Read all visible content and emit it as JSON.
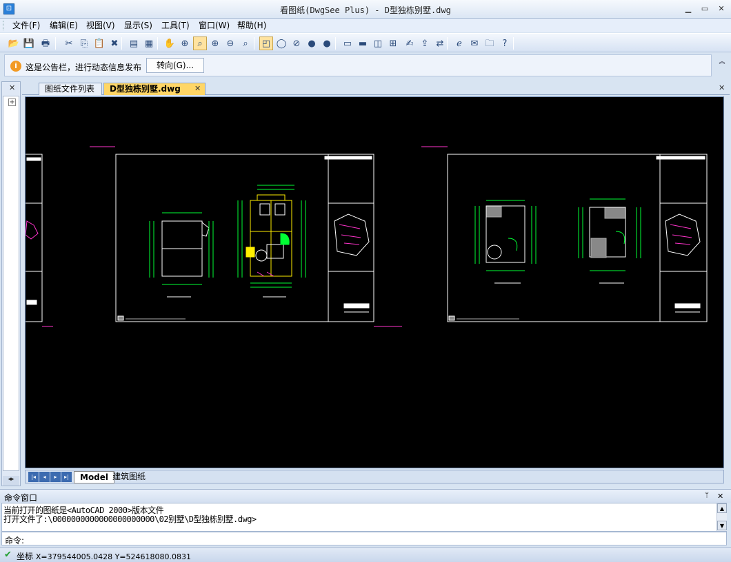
{
  "window": {
    "title": "看图纸(DwgSee Plus) - D型独栋别墅.dwg",
    "minimize": "▁",
    "maximize": "▭",
    "close": "✕"
  },
  "menu": [
    {
      "label": "文件(F)"
    },
    {
      "label": "编辑(E)"
    },
    {
      "label": "视图(V)"
    },
    {
      "label": "显示(S)"
    },
    {
      "label": "工具(T)"
    },
    {
      "label": "窗口(W)"
    },
    {
      "label": "帮助(H)"
    }
  ],
  "toolbar": {
    "icons": [
      {
        "name": "open-icon",
        "glyph": "📂"
      },
      {
        "name": "save-icon",
        "glyph": "💾"
      },
      {
        "name": "print-icon",
        "glyph": "🖶"
      },
      {
        "name": "cut-icon",
        "glyph": "✂"
      },
      {
        "name": "copy-icon",
        "glyph": "⎘"
      },
      {
        "name": "paste-icon",
        "glyph": "📋"
      },
      {
        "name": "delete-icon",
        "glyph": "✖"
      },
      {
        "name": "list-icon",
        "glyph": "▤"
      },
      {
        "name": "select-icon",
        "glyph": "▦"
      },
      {
        "name": "pan-icon",
        "glyph": "✋"
      },
      {
        "name": "zoom-window-icon",
        "glyph": "⊕"
      },
      {
        "name": "zoom-extents-icon",
        "glyph": "⌕"
      },
      {
        "name": "zoom-in-icon",
        "glyph": "⊕"
      },
      {
        "name": "zoom-out-icon",
        "glyph": "⊖"
      },
      {
        "name": "zoom-previous-icon",
        "glyph": "⌕"
      },
      {
        "name": "layer-icon",
        "glyph": "◰"
      },
      {
        "name": "circle-outline-icon",
        "glyph": "◯"
      },
      {
        "name": "circle-slash-icon",
        "glyph": "⊘"
      },
      {
        "name": "circle-fill-icon",
        "glyph": "●"
      },
      {
        "name": "circle-fill-2-icon",
        "glyph": "●"
      },
      {
        "name": "window-icon",
        "glyph": "▭"
      },
      {
        "name": "layout-icon",
        "glyph": "▬"
      },
      {
        "name": "split-icon",
        "glyph": "◫"
      },
      {
        "name": "measure-icon",
        "glyph": "⊞"
      },
      {
        "name": "text-icon",
        "glyph": "✍"
      },
      {
        "name": "export-icon",
        "glyph": "⇪"
      },
      {
        "name": "convert-icon",
        "glyph": "⇄"
      },
      {
        "name": "browser-icon",
        "glyph": "ℯ"
      },
      {
        "name": "send-icon",
        "glyph": "✉"
      },
      {
        "name": "folder-icon",
        "glyph": "🗀"
      },
      {
        "name": "help-icon",
        "glyph": "?"
      }
    ]
  },
  "notice": {
    "icon": "i",
    "text": "这是公告栏，进行动态信息发布",
    "button": "转向(G)...",
    "chevron": "︽"
  },
  "left_panel": {
    "close": "✕",
    "tree_toggle": "+",
    "arrows": "◂▸"
  },
  "tabs": [
    {
      "label": "图纸文件列表",
      "active": false
    },
    {
      "label": "D型独栋别墅.dwg",
      "active": true
    }
  ],
  "tab_close": "✕",
  "tabrow_close": "✕",
  "sheets": {
    "nav": [
      "|◂",
      "◂",
      "▸",
      "▸|"
    ],
    "tabs": [
      {
        "label": "Model",
        "active": true
      },
      {
        "label": "建筑图纸",
        "active": false
      }
    ]
  },
  "command": {
    "header": "命令窗口",
    "pin": "ᛘ",
    "close": "✕",
    "log": [
      "当前打开的图纸是<AutoCAD 2000>版本文件",
      "打开文件了:\\0000000000000000000000\\02别墅\\D型独栋别墅.dwg>"
    ],
    "prompt": "命令:",
    "scroll_up": "▲",
    "scroll_down": "▼"
  },
  "status": {
    "check": "✔",
    "coordinates_label": "坐标",
    "coordinates_value": "X=379544005.0428 Y=524618080.0831"
  },
  "colors": {
    "canvas_bg": "#000000",
    "cad_white": "#ffffff",
    "cad_green": "#00ff33",
    "cad_yellow": "#ffee00",
    "cad_magenta": "#ff33cc",
    "active_tab": "#ffd666"
  }
}
